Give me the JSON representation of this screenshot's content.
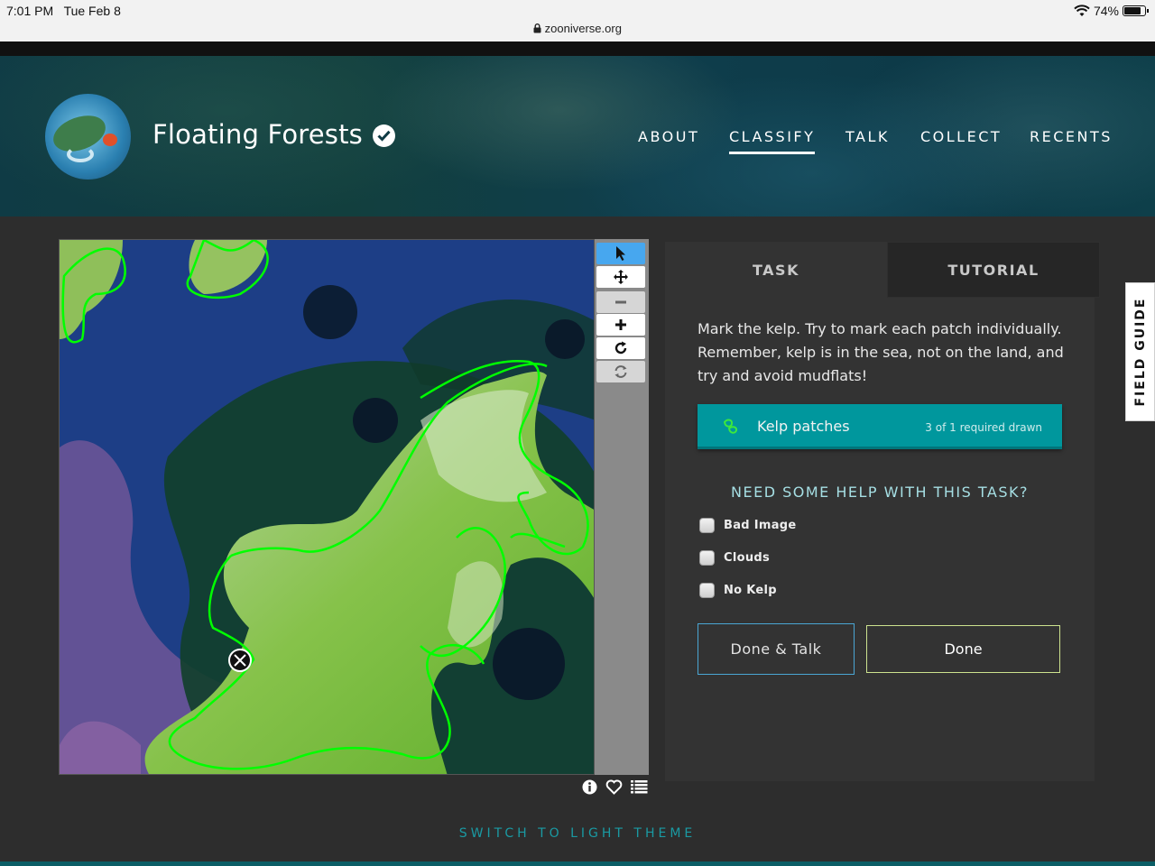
{
  "statusbar": {
    "time": "7:01 PM",
    "date": "Tue Feb 8",
    "battery": "74%",
    "url": "zooniverse.org"
  },
  "header": {
    "title": "Floating Forests",
    "nav": [
      {
        "label": "ABOUT",
        "active": false
      },
      {
        "label": "CLASSIFY",
        "active": true
      },
      {
        "label": "TALK",
        "active": false
      },
      {
        "label": "COLLECT",
        "active": false
      },
      {
        "label": "RECENTS",
        "active": false
      }
    ]
  },
  "toolbar": {
    "tools": [
      "pointer-icon",
      "move-icon",
      "zoom-out-icon",
      "zoom-in-icon",
      "rotate-icon",
      "reset-icon"
    ]
  },
  "meta_icons": [
    "info-icon",
    "heart-icon",
    "list-icon"
  ],
  "task": {
    "tabs": {
      "task": "TASK",
      "tutorial": "TUTORIAL"
    },
    "instructions": "Mark the kelp. Try to mark each patch individually. Remember, kelp is in the sea, not on the land, and try and avoid mudflats!",
    "tool_label": "Kelp patches",
    "tool_count": "3 of 1 required drawn",
    "help_title": "NEED SOME HELP WITH THIS TASK?",
    "checkboxes": [
      "Bad Image",
      "Clouds",
      "No Kelp"
    ],
    "done_talk": "Done & Talk",
    "done": "Done"
  },
  "field_guide": "FIELD GUIDE",
  "theme_switch": "SWITCH TO LIGHT THEME",
  "colors": {
    "accent_teal": "#00979d",
    "outline_green": "#00ff00",
    "done_border": "#cde38f",
    "talk_border": "#4aa6d4"
  }
}
